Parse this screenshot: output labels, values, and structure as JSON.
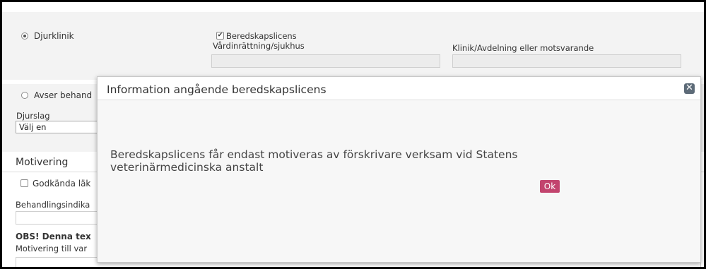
{
  "form": {
    "djurklinik_label": "Djurklinik",
    "beredskapslicens_label": "Beredskapslicens",
    "vardinrattning_label": "Vårdinrättning/sjukhus",
    "klinik_label": "Klinik/Avdelning eller motsvarande",
    "avser_label": "Avser behand",
    "djurslag_label": "Djurslag",
    "djurslag_value": "Välj en",
    "motivering_title": "Motivering",
    "godkanda_label": "Godkända läk",
    "behandlingsindikation_label": "Behandlingsindika",
    "obs_label": "OBS! Denna tex",
    "motivering_till_label": "Motivering till var"
  },
  "modal": {
    "title": "Information angående beredskapslicens",
    "message": "Beredskapslicens får endast motiveras av förskrivare verksam vid Statens veterinärmedicinska anstalt",
    "ok_label": "Ok",
    "close_icon": "close-icon"
  },
  "colors": {
    "ok_button": "#c2446e",
    "close_button": "#5d6b78"
  }
}
